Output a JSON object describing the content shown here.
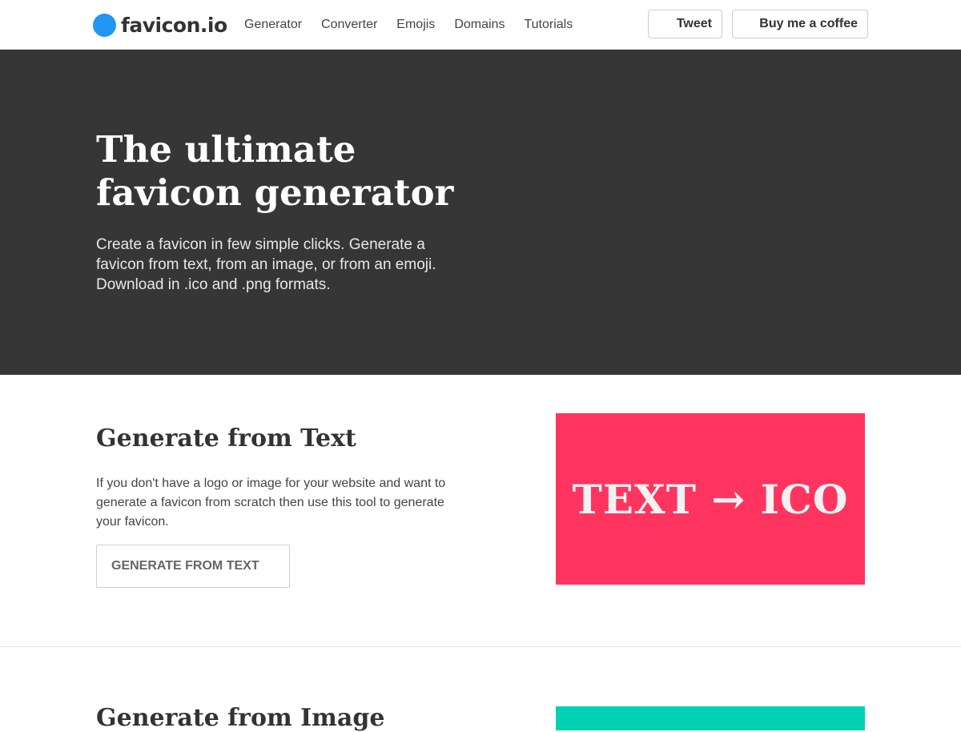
{
  "navbar": {
    "brand": "favicon.io",
    "links": [
      "Generator",
      "Converter",
      "Emojis",
      "Domains",
      "Tutorials"
    ],
    "tweet_label": "Tweet",
    "coffee_label": "Buy me a coffee"
  },
  "hero": {
    "title": "The ultimate favicon generator",
    "subtitle": "Create a favicon in few simple clicks. Generate a favicon from text, from an image, or from an emoji. Download in .ico and .png formats.",
    "background": "#363636"
  },
  "sections": [
    {
      "title": "Generate from Text",
      "description": "If you don't have a logo or image for your website and want to generate a favicon from scratch then use this tool to generate your favicon.",
      "button_label": "GENERATE FROM TEXT",
      "preview_label": "TEXT → ICO",
      "preview_color": "#ff3560"
    },
    {
      "title": "Generate from Image",
      "preview_color": "#00d1b2"
    }
  ],
  "colors": {
    "brand_dot": "#2196f3"
  }
}
